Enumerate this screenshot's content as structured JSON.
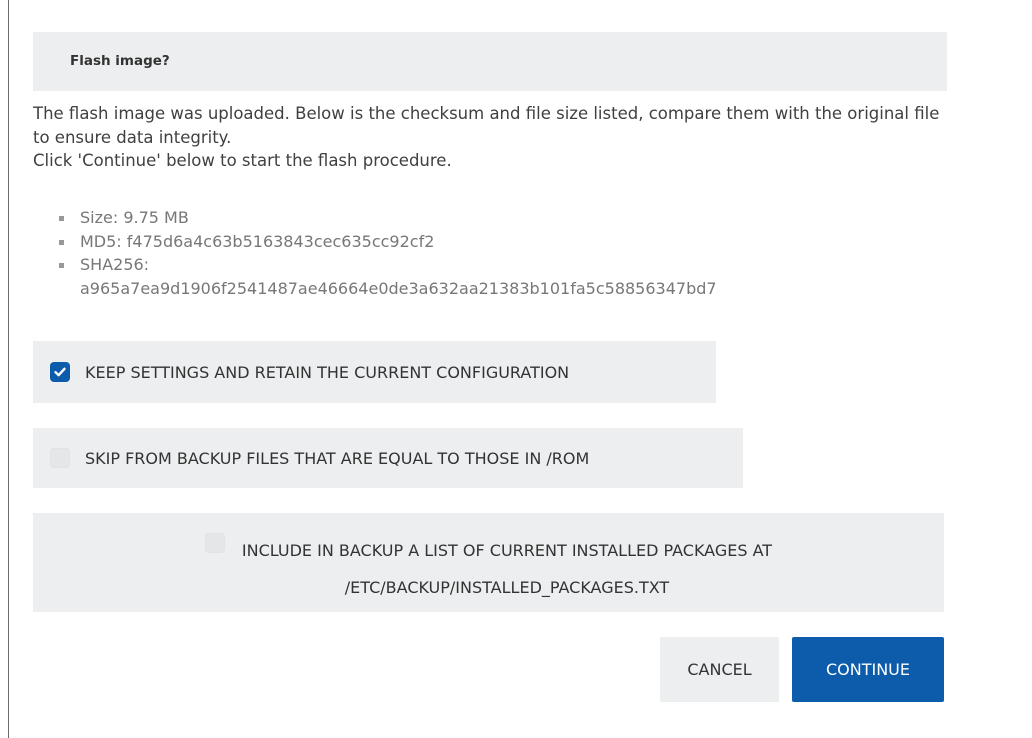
{
  "dialog": {
    "title": "Flash image?",
    "intro_line1": "The flash image was uploaded. Below is the checksum and file size listed, compare them with the original file to ensure data integrity.",
    "intro_line2": "Click 'Continue' below to start the flash procedure."
  },
  "info": {
    "size": "Size: 9.75 MB",
    "md5": "MD5: f475d6a4c63b5163843cec635cc92cf2",
    "sha256_label": "SHA256:",
    "sha256_value": "a965a7ea9d1906f2541487ae46664e0de3a632aa21383b101fa5c58856347bd7"
  },
  "options": {
    "keep_settings": {
      "label": "KEEP SETTINGS AND RETAIN THE CURRENT CONFIGURATION",
      "checked": true
    },
    "skip_backup": {
      "label": "SKIP FROM BACKUP FILES THAT ARE EQUAL TO THOSE IN /ROM",
      "checked": false
    },
    "include_packages": {
      "label_line1": "INCLUDE IN BACKUP A LIST OF CURRENT INSTALLED PACKAGES AT",
      "label_line2": "/ETC/BACKUP/INSTALLED_PACKAGES.TXT",
      "checked": false
    }
  },
  "buttons": {
    "cancel": "CANCEL",
    "continue": "CONTINUE"
  },
  "colors": {
    "accent": "#0d5cab",
    "panel": "#eceeef"
  },
  "icons": {
    "checkmark": "checkmark-icon"
  }
}
